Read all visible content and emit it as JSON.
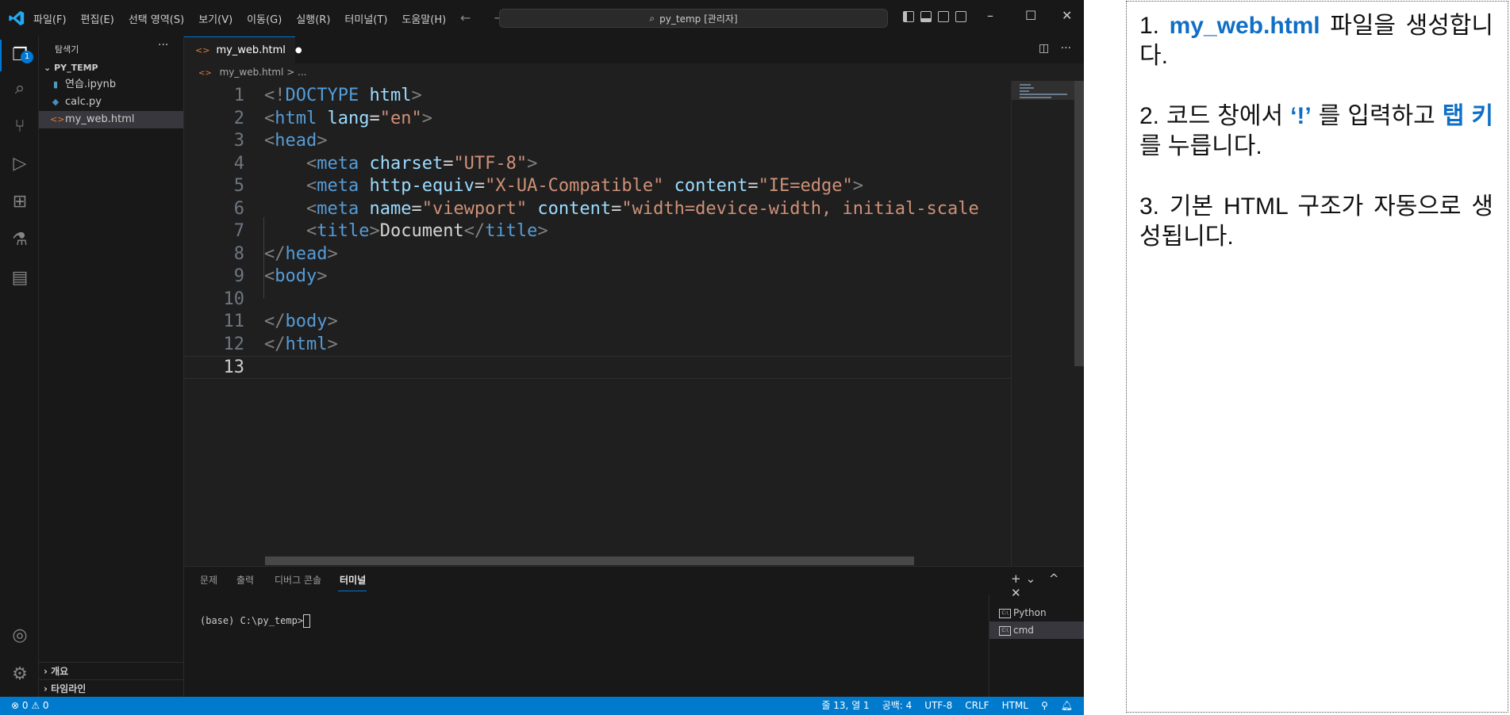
{
  "titlebar": {
    "menus": [
      "파일(F)",
      "편집(E)",
      "선택 영역(S)",
      "보기(V)",
      "이동(G)",
      "실행(R)",
      "터미널(T)",
      "도움말(H)"
    ],
    "search": "py_temp [관리자]",
    "nav": "← →"
  },
  "activity": {
    "explorer_badge": "1"
  },
  "sidebar": {
    "title": "탐색기",
    "more": "···",
    "folder": "PY_TEMP",
    "files": [
      {
        "name": "연습.ipynb",
        "icon": "notebook-icon"
      },
      {
        "name": "calc.py",
        "icon": "python-icon"
      },
      {
        "name": "my_web.html",
        "icon": "html-icon"
      }
    ],
    "outline": "개요",
    "timeline": "타임라인"
  },
  "tab": {
    "name": "my_web.html",
    "modified": "●"
  },
  "breadcrumb": {
    "file": "my_web.html",
    "rest": "> ..."
  },
  "editor": {
    "current_line": 13,
    "lines": [
      {
        "n": "1",
        "tokens": [
          [
            "t-punct",
            "<!"
          ],
          [
            "t-tag",
            "DOCTYPE"
          ],
          [
            "t-text",
            " "
          ],
          [
            "t-attr",
            "html"
          ],
          [
            "t-punct",
            ">"
          ]
        ]
      },
      {
        "n": "2",
        "tokens": [
          [
            "t-punct",
            "<"
          ],
          [
            "t-tag",
            "html"
          ],
          [
            "t-text",
            " "
          ],
          [
            "t-attr",
            "lang"
          ],
          [
            "t-text",
            "="
          ],
          [
            "t-str",
            "\"en\""
          ],
          [
            "t-punct",
            ">"
          ]
        ]
      },
      {
        "n": "3",
        "tokens": [
          [
            "t-punct",
            "<"
          ],
          [
            "t-tag",
            "head"
          ],
          [
            "t-punct",
            ">"
          ]
        ]
      },
      {
        "n": "4",
        "tokens": [
          [
            "t-text",
            "    "
          ],
          [
            "t-punct",
            "<"
          ],
          [
            "t-tag",
            "meta"
          ],
          [
            "t-text",
            " "
          ],
          [
            "t-attr",
            "charset"
          ],
          [
            "t-text",
            "="
          ],
          [
            "t-str",
            "\"UTF-8\""
          ],
          [
            "t-punct",
            ">"
          ]
        ]
      },
      {
        "n": "5",
        "tokens": [
          [
            "t-text",
            "    "
          ],
          [
            "t-punct",
            "<"
          ],
          [
            "t-tag",
            "meta"
          ],
          [
            "t-text",
            " "
          ],
          [
            "t-attr",
            "http-equiv"
          ],
          [
            "t-text",
            "="
          ],
          [
            "t-str",
            "\"X-UA-Compatible\""
          ],
          [
            "t-text",
            " "
          ],
          [
            "t-attr",
            "content"
          ],
          [
            "t-text",
            "="
          ],
          [
            "t-str",
            "\"IE=edge\""
          ],
          [
            "t-punct",
            ">"
          ]
        ]
      },
      {
        "n": "6",
        "tokens": [
          [
            "t-text",
            "    "
          ],
          [
            "t-punct",
            "<"
          ],
          [
            "t-tag",
            "meta"
          ],
          [
            "t-text",
            " "
          ],
          [
            "t-attr",
            "name"
          ],
          [
            "t-text",
            "="
          ],
          [
            "t-str",
            "\"viewport\""
          ],
          [
            "t-text",
            " "
          ],
          [
            "t-attr",
            "content"
          ],
          [
            "t-text",
            "="
          ],
          [
            "t-str",
            "\"width=device-width, initial-scale"
          ]
        ]
      },
      {
        "n": "7",
        "tokens": [
          [
            "t-text",
            "    "
          ],
          [
            "t-punct",
            "<"
          ],
          [
            "t-tag",
            "title"
          ],
          [
            "t-punct",
            ">"
          ],
          [
            "t-text",
            "Document"
          ],
          [
            "t-punct",
            "</"
          ],
          [
            "t-tag",
            "title"
          ],
          [
            "t-punct",
            ">"
          ]
        ]
      },
      {
        "n": "8",
        "tokens": [
          [
            "t-punct",
            "</"
          ],
          [
            "t-tag",
            "head"
          ],
          [
            "t-punct",
            ">"
          ]
        ]
      },
      {
        "n": "9",
        "tokens": [
          [
            "t-punct",
            "<"
          ],
          [
            "t-tag",
            "body"
          ],
          [
            "t-punct",
            ">"
          ]
        ]
      },
      {
        "n": "10",
        "tokens": []
      },
      {
        "n": "11",
        "tokens": [
          [
            "t-punct",
            "</"
          ],
          [
            "t-tag",
            "body"
          ],
          [
            "t-punct",
            ">"
          ]
        ]
      },
      {
        "n": "12",
        "tokens": [
          [
            "t-punct",
            "</"
          ],
          [
            "t-tag",
            "html"
          ],
          [
            "t-punct",
            ">"
          ]
        ]
      },
      {
        "n": "13",
        "tokens": []
      }
    ]
  },
  "panel": {
    "tabs": [
      "문제",
      "출력",
      "디버그 콘솔",
      "터미널"
    ],
    "active_tab": 3,
    "actions": "+⌄ ^ ✕",
    "terminal_prompt": "(base) C:\\py_temp>",
    "terminals": [
      "Python",
      "cmd"
    ]
  },
  "statusbar": {
    "problems": "⊗ 0 ⚠ 0",
    "position": "줄 13, 열 1",
    "spaces": "공백: 4",
    "encoding": "UTF-8",
    "eol": "CRLF",
    "language": "HTML"
  },
  "instructions": {
    "step1": {
      "num": "1. ",
      "hl": "my_web.html",
      "rest": " 파일을 생성합니다."
    },
    "step2": {
      "num": "2. 코드 창에서 ",
      "hl": "‘!’",
      "mid": " 를 입력하고 ",
      "hl2": "탭 키",
      "rest": "를 누릅니다."
    },
    "step3": {
      "text": "3. 기본 HTML 구조가 자동으로 생성됩니다."
    }
  }
}
